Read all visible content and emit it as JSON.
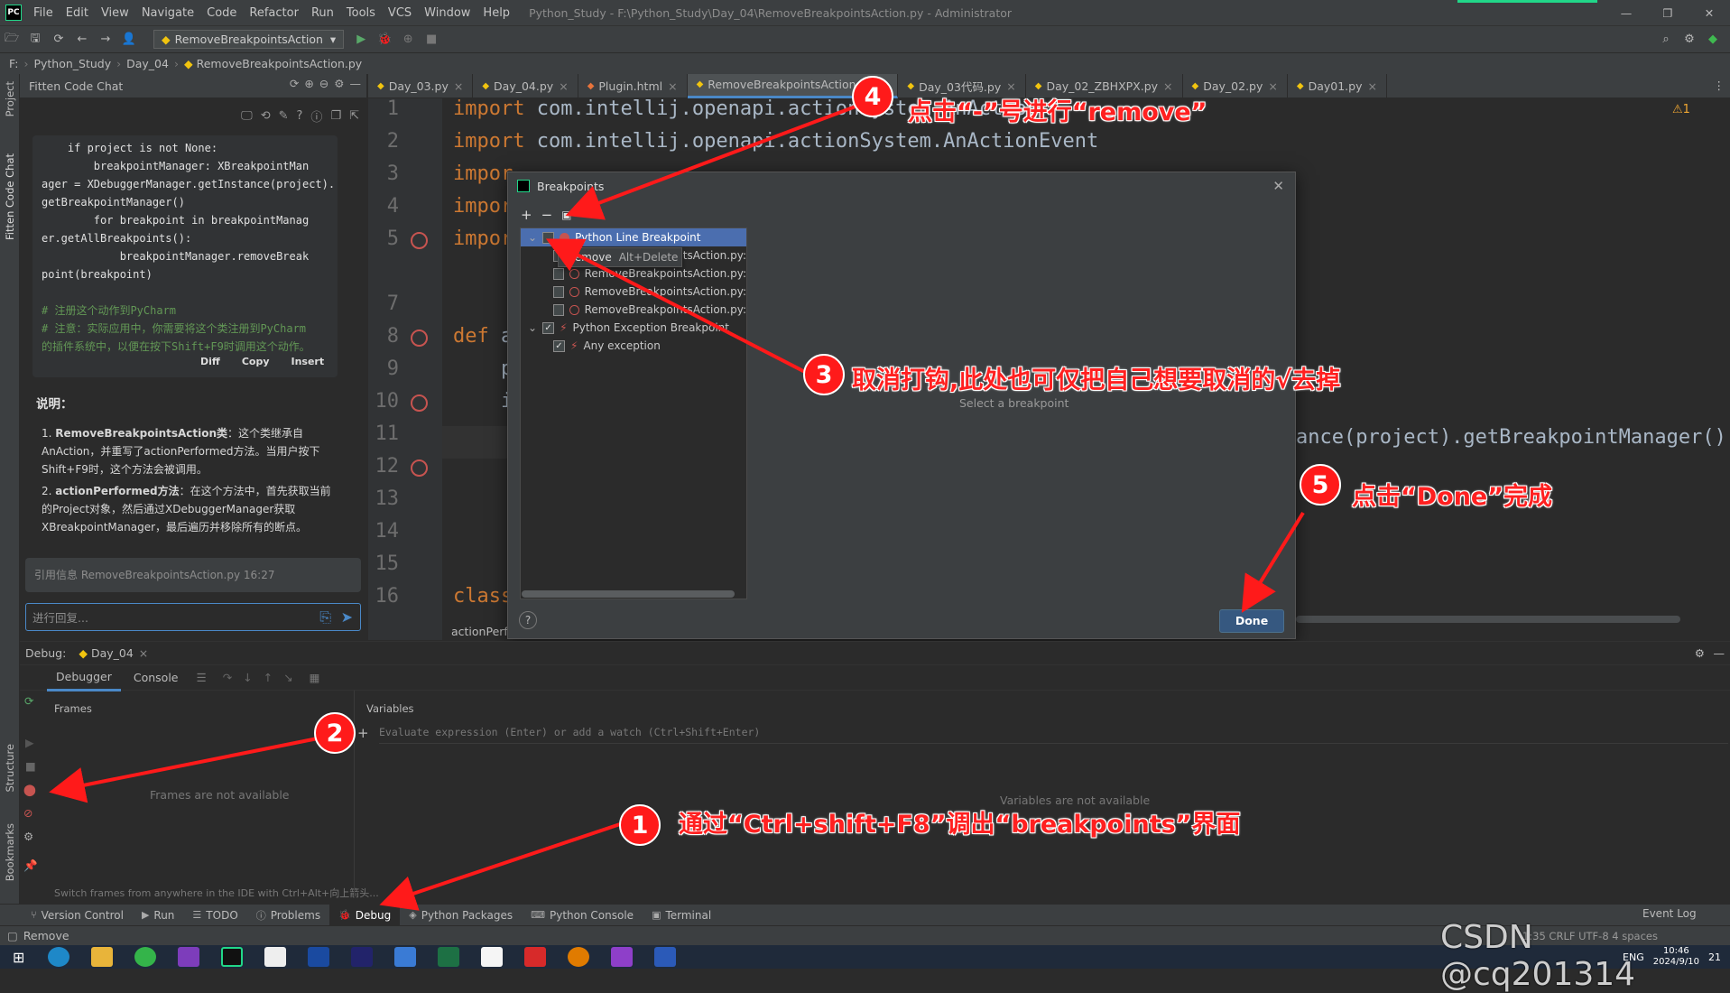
{
  "window": {
    "title": "Python_Study - F:\\Python_Study\\Day_04\\RemoveBreakpointsAction.py - Administrator",
    "logo": "PC"
  },
  "menu": [
    "File",
    "Edit",
    "View",
    "Navigate",
    "Code",
    "Refactor",
    "Run",
    "Tools",
    "VCS",
    "Window",
    "Help"
  ],
  "toolbar": {
    "run_config": "RemoveBreakpointsAction"
  },
  "breadcrumb": [
    "F:",
    "Python_Study",
    "Day_04",
    "RemoveBreakpointsAction.py"
  ],
  "left_strip": {
    "project": "Project",
    "fitten": "Fitten Code Chat",
    "structure": "Structure",
    "bookmarks": "Bookmarks"
  },
  "chat": {
    "title": "Fitten Code Chat",
    "code_lines": [
      "    if project is not None:",
      "        breakpointManager: XBreakpointMan",
      "ager = XDebuggerManager.getInstance(project).",
      "getBreakpointManager()",
      "        for breakpoint in breakpointManag",
      "er.getAllBreakpoints():",
      "            breakpointManager.removeBreak",
      "point(breakpoint)",
      "",
      "# 注册这个动作到PyCharm",
      "# 注意：实际应用中，你需要将这个类注册到PyCharm",
      "的插件系统中，以便在按下Shift+F9时调用这个动作。"
    ],
    "actions": [
      "Diff",
      "Copy",
      "Insert"
    ],
    "section": "说明：",
    "items": [
      {
        "head": "RemoveBreakpointsAction类",
        "text": "：这个类继承自AnAction，并重写了actionPerformed方法。当用户按下Shift+F9时，这个方法会被调用。"
      },
      {
        "head": "actionPerformed方法",
        "text": "：在这个方法中，首先获取当前的Project对象，然后通过XDebuggerManager获取XBreakpointManager，最后遍历并移除所有的断点。"
      }
    ],
    "ref": "引用信息 RemoveBreakpointsAction.py 16:27",
    "input_placeholder": "进行回复..."
  },
  "tabs": [
    "Day_03.py",
    "Day_04.py",
    "Plugin.html",
    "RemoveBreakpointsAction.py",
    "Day_03代码.py",
    "Day_02_ZBHXPX.py",
    "Day_02.py",
    "Day01.py"
  ],
  "editor": {
    "lines": [
      {
        "n": "1",
        "code": "import com.intellij.openapi.actionSystem.AnAction"
      },
      {
        "n": "2",
        "code": "import com.intellij.openapi.actionSystem.AnActionEvent"
      },
      {
        "n": "3",
        "code": "impor"
      },
      {
        "n": "4",
        "code": "impor"
      },
      {
        "n": "5",
        "code": "impor"
      },
      {
        "n": "7",
        "code": ""
      },
      {
        "n": "8",
        "code": "def a"
      },
      {
        "n": "9",
        "code": "    p"
      },
      {
        "n": "10",
        "code": "    i"
      },
      {
        "n": "11",
        "code": ""
      },
      {
        "n": "12",
        "code": ""
      },
      {
        "n": "13",
        "code": ""
      },
      {
        "n": "14",
        "code": ""
      },
      {
        "n": "15",
        "code": ""
      },
      {
        "n": "16",
        "code": "class"
      }
    ],
    "right_fragment": "ance(project).getBreakpointManager()",
    "inspection": "⚠1",
    "crumb": "actionPerf"
  },
  "dialog": {
    "title": "Breakpoints",
    "tree": [
      {
        "label": "Python Line Breakpoint",
        "checked": false,
        "selected": true
      },
      {
        "label": "RemoveBreakpointsAction.py:",
        "checked": false
      },
      {
        "label": "RemoveBreakpointsAction.py:",
        "checked": false
      },
      {
        "label": "RemoveBreakpointsAction.py:",
        "checked": false
      },
      {
        "label": "RemoveBreakpointsAction.py:",
        "checked": false
      },
      {
        "label": "Python Exception Breakpoint",
        "checked": true
      },
      {
        "label": "Any exception",
        "checked": true
      }
    ],
    "context_menu": {
      "label": "Remove",
      "shortcut": "Alt+Delete"
    },
    "empty_text": "Select a breakpoint",
    "done": "Done",
    "help": "?"
  },
  "debug": {
    "title": "Debug:",
    "config": "Day_04",
    "tabs": [
      "Debugger",
      "Console"
    ],
    "frames": "Frames",
    "frames_empty": "Frames are not available",
    "variables": "Variables",
    "vars_empty": "Variables are not available",
    "eval_placeholder": "Evaluate expression (Enter) or add a watch (Ctrl+Shift+Enter)",
    "hint": "Switch frames from anywhere in the IDE with Ctrl+Alt+向上箭头..."
  },
  "bottom_tools": [
    "Version Control",
    "Run",
    "TODO",
    "Problems",
    "Debug",
    "Python Packages",
    "Python Console",
    "Terminal"
  ],
  "event_log": "Event Log",
  "status": {
    "left": "Remove",
    "right": "1:35  CRLF  UTF-8  4 spaces"
  },
  "taskbar": {
    "time": "10:46",
    "date": "2024/9/10",
    "lang": "ENG",
    "notif": "21"
  },
  "watermark": "CSDN @cq201314",
  "annotations": [
    {
      "num": "1",
      "text": "通过“Ctrl+shift+F8”调出“breakpoints”界面"
    },
    {
      "num": "2",
      "text": ""
    },
    {
      "num": "3",
      "text": "取消打钩,此处也可仅把自己想要取消的√去掉"
    },
    {
      "num": "4",
      "text": "点击“-”号进行“remove”"
    },
    {
      "num": "5",
      "text": "点击“Done”完成"
    }
  ],
  "colors": {
    "annotation": "#ff2020",
    "accent": "#4a88c7",
    "breakpoint": "#c75450"
  }
}
